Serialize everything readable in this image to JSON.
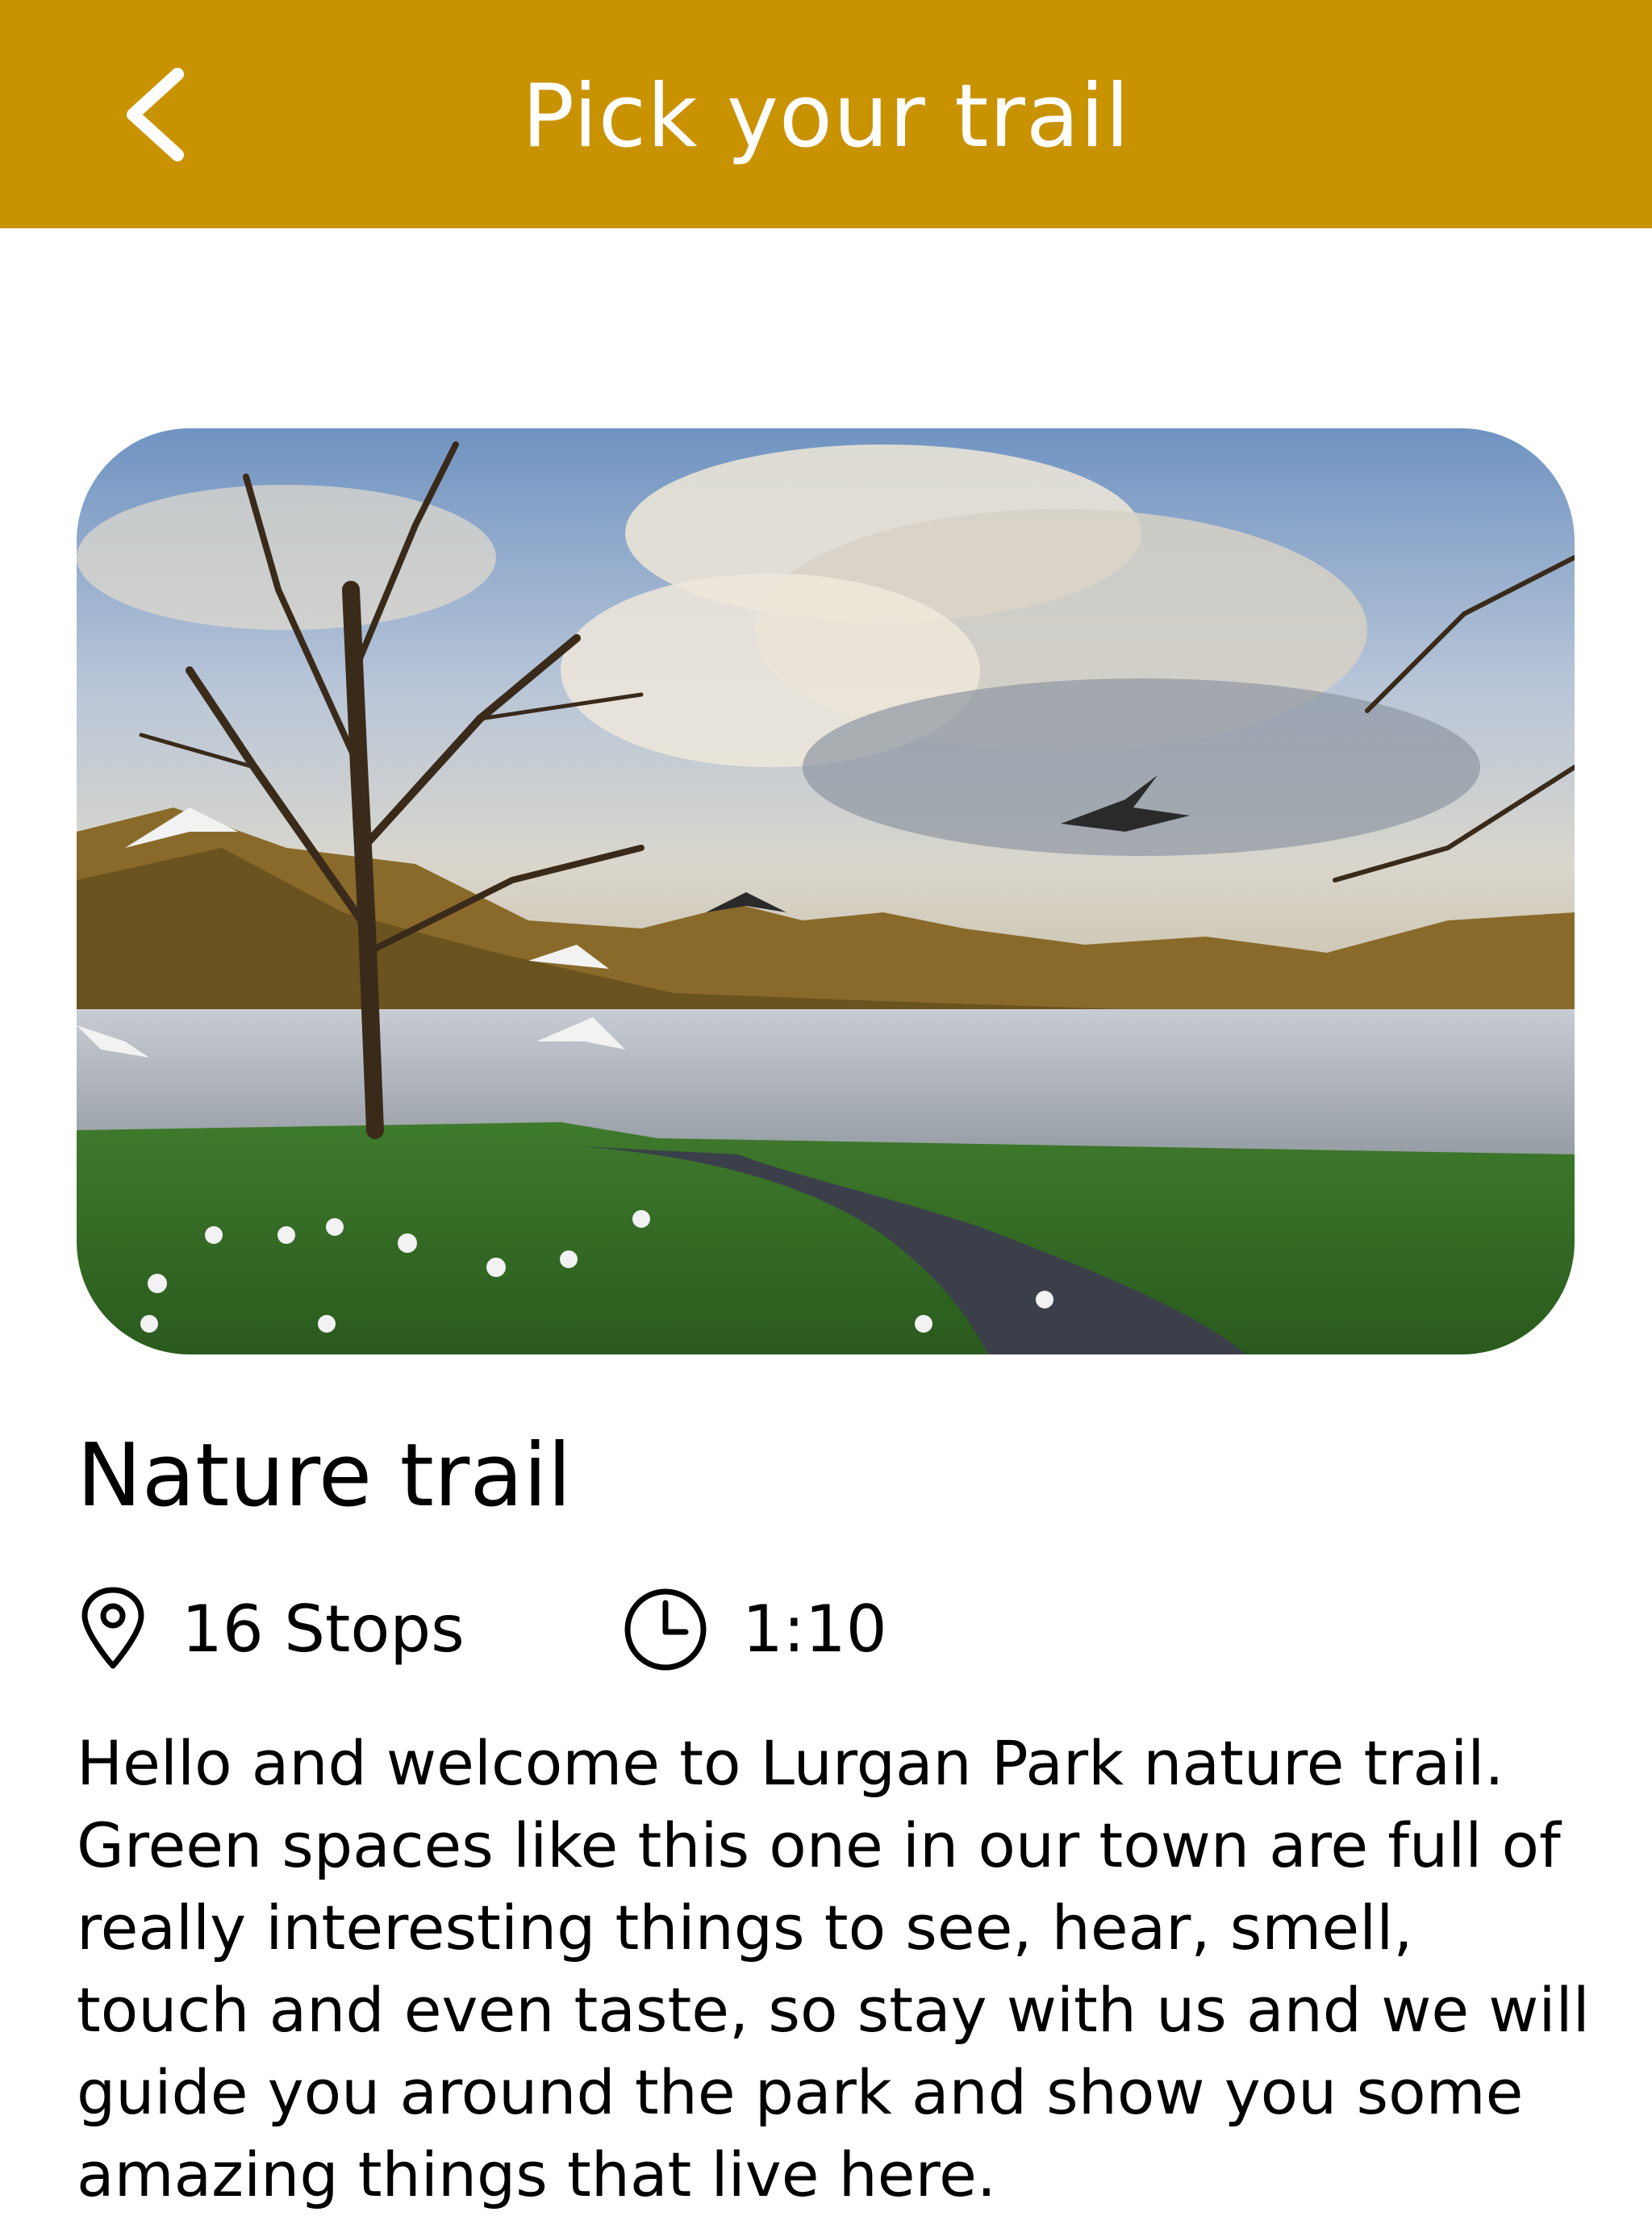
{
  "header": {
    "title": "Pick your trail",
    "back_icon": "chevron-left-icon"
  },
  "colors": {
    "header_background": "#c99200",
    "header_text": "#ffffff",
    "body_text": "#000000"
  },
  "trail": {
    "image_icon": "lake-park-photo",
    "name": "Nature trail",
    "stops_icon": "map-pin-icon",
    "stops": "16 Stops",
    "duration_icon": "clock-icon",
    "duration": "1:10",
    "description": "Hello and welcome to Lurgan Park nature trail. Green spaces like this one in our town are full of really interesting things to see, hear, smell, touch and even taste, so stay with us and we will guide you around the park and show you some amazing things that live here."
  }
}
